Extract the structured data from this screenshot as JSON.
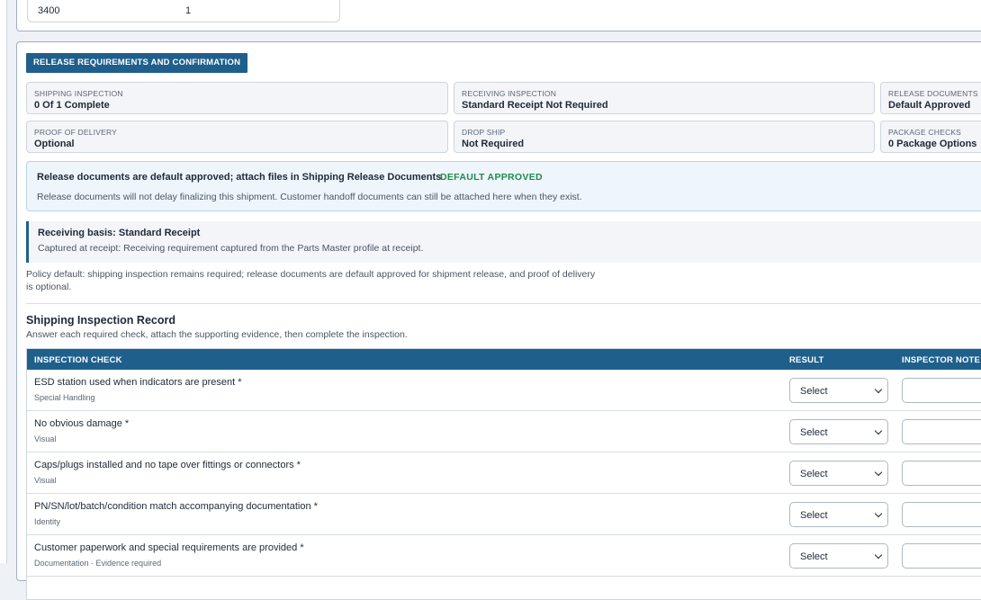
{
  "top_row": {
    "c1": "3400",
    "c2": "1"
  },
  "section_title": "RELEASE REQUIREMENTS AND CONFIRMATION",
  "cards": [
    {
      "label": "SHIPPING INSPECTION",
      "value": "0 Of 1 Complete"
    },
    {
      "label": "RECEIVING INSPECTION",
      "value": "Standard Receipt Not Required"
    },
    {
      "label": "RELEASE DOCUMENTS",
      "value": "Default Approved"
    },
    {
      "label": "PROOF OF DELIVERY",
      "value": "Optional"
    },
    {
      "label": "DROP SHIP",
      "value": "Not Required"
    },
    {
      "label": "PACKAGE CHECKS",
      "value": "0 Package Options"
    }
  ],
  "info": {
    "title": "Release documents are default approved; attach files in Shipping Release Documents",
    "badge": "DEFAULT APPROVED",
    "body": "Release documents will not delay finalizing this shipment. Customer handoff documents can still be attached here when they exist."
  },
  "basis": {
    "title": "Receiving basis: Standard Receipt",
    "body": "Captured at receipt: Receiving requirement captured from the Parts Master profile at receipt."
  },
  "policy": "Policy default: shipping inspection remains required; release documents are default approved for shipment release, and proof of delivery is optional.",
  "inspection": {
    "title": "Shipping Inspection Record",
    "subtitle": "Answer each required check, attach the supporting evidence, then complete the inspection.",
    "columns": [
      "INSPECTION CHECK",
      "RESULT",
      "INSPECTOR NOTE"
    ],
    "rows": [
      {
        "check": "ESD station used when indicators are present *",
        "category": "Special Handling",
        "result": "Select"
      },
      {
        "check": "No obvious damage *",
        "category": "Visual",
        "result": "Select"
      },
      {
        "check": "Caps/plugs installed and no tape over fittings or connectors *",
        "category": "Visual",
        "result": "Select"
      },
      {
        "check": "PN/SN/lot/batch/condition match accompanying documentation *",
        "category": "Identity",
        "result": "Select"
      },
      {
        "check": "Customer paperwork and special requirements are provided *",
        "category": "Documentation · Evidence required",
        "result": "Select"
      }
    ]
  }
}
